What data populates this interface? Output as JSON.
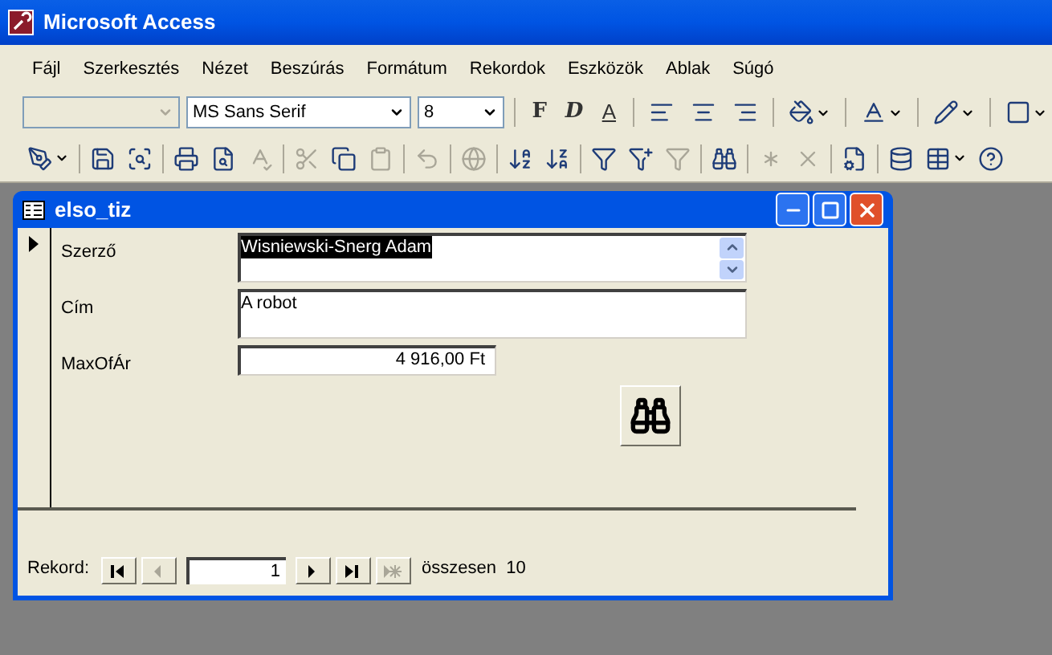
{
  "window": {
    "title": "Microsoft Access"
  },
  "menu": [
    "Fájl",
    "Szerkesztés",
    "Nézet",
    "Beszúrás",
    "Formátum",
    "Rekordok",
    "Eszközök",
    "Ablak",
    "Súgó"
  ],
  "format_toolbar": {
    "object_combo": {
      "disabled": true
    },
    "font_combo": {
      "value": "MS Sans Serif"
    },
    "size_combo": {
      "value": "8"
    },
    "style_buttons": [
      {
        "label": "F",
        "kind": "bold"
      },
      {
        "label": "D",
        "kind": "italic"
      },
      {
        "label": "A",
        "kind": "underline"
      }
    ],
    "tools": [
      {
        "kind": "align-left"
      },
      {
        "kind": "align-center"
      },
      {
        "kind": "align-right"
      },
      {
        "kind": "fill"
      },
      {
        "kind": "font-color"
      },
      {
        "kind": "line-color"
      },
      {
        "kind": "border"
      }
    ]
  },
  "database_toolbar": [
    {
      "kind": "design",
      "disabled": false
    },
    {
      "kind": "save",
      "disabled": false
    },
    {
      "kind": "search",
      "disabled": false
    },
    {
      "kind": "print",
      "disabled": false
    },
    {
      "kind": "preview",
      "disabled": false
    },
    {
      "kind": "spell",
      "disabled": true
    },
    {
      "kind": "cut",
      "disabled": true
    },
    {
      "kind": "copy",
      "disabled": false
    },
    {
      "kind": "paste",
      "disabled": true
    },
    {
      "kind": "undo",
      "disabled": true
    },
    {
      "kind": "link",
      "disabled": true
    },
    {
      "kind": "sort-asc",
      "disabled": false
    },
    {
      "kind": "sort-desc",
      "disabled": false
    },
    {
      "kind": "filter-selection",
      "disabled": false
    },
    {
      "kind": "filter-form",
      "disabled": false
    },
    {
      "kind": "filter",
      "disabled": true
    },
    {
      "kind": "find",
      "disabled": false
    },
    {
      "kind": "new-record",
      "disabled": true
    },
    {
      "kind": "delete-record",
      "disabled": true
    },
    {
      "kind": "properties",
      "disabled": false
    },
    {
      "kind": "database",
      "disabled": false
    },
    {
      "kind": "new-object",
      "disabled": false
    },
    {
      "kind": "help",
      "disabled": false
    }
  ],
  "form_window": {
    "title": "elso_tiz",
    "fields": [
      {
        "label": "Szerző",
        "value": "Wisniewski-Snerg Adam",
        "kind": "scroll",
        "selected": true
      },
      {
        "label": "Cím",
        "value": "A robot",
        "kind": "multiline",
        "selected": false
      },
      {
        "label": "MaxOfÁr",
        "value": "4 916,00 Ft",
        "kind": "number",
        "selected": false
      }
    ],
    "navigation": {
      "label": "Rekord:",
      "current": "1",
      "total_label": "összesen",
      "total": "10",
      "buttons": [
        {
          "kind": "first",
          "disabled": false
        },
        {
          "kind": "prev",
          "disabled": true
        },
        {
          "kind": "next",
          "disabled": false
        },
        {
          "kind": "last",
          "disabled": false
        },
        {
          "kind": "new",
          "disabled": true
        }
      ]
    }
  }
}
